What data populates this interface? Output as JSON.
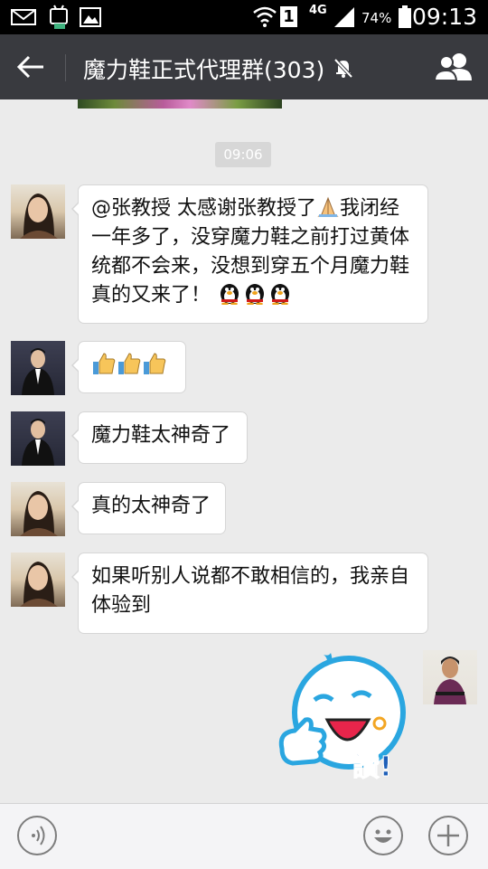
{
  "status_bar": {
    "signal_mode": "4G",
    "sim_badge": "1",
    "battery_percent": "74%",
    "time": "09:13",
    "icons": [
      "mail-icon",
      "android-icon",
      "image-icon",
      "wifi-icon",
      "signal-icon",
      "battery-icon"
    ]
  },
  "header": {
    "title": "魔力鞋正式代理群(303)",
    "icons": [
      "back-arrow-icon",
      "mute-bell-icon",
      "group-members-icon"
    ]
  },
  "chat": {
    "timestamp": "09:06",
    "messages": [
      {
        "sender": "woman-avatar",
        "text": "@张教授 太感谢张教授了",
        "text_after": "我闭经一年多了，没穿魔力鞋之前打过黄体统都不会来，没想到穿五个月魔力鞋真的又来了！",
        "emoji": [
          "pray-emoji",
          "penguin-emoji",
          "penguin-emoji",
          "penguin-emoji"
        ]
      },
      {
        "sender": "man-avatar",
        "text": "",
        "emoji": [
          "thumbs-up-emoji",
          "thumbs-up-emoji",
          "thumbs-up-emoji"
        ]
      },
      {
        "sender": "man-avatar",
        "text": "魔力鞋太神奇了"
      },
      {
        "sender": "woman-avatar",
        "text": "真的太神奇了"
      },
      {
        "sender": "woman-avatar",
        "text": "如果听别人说都不敢相信的，我亲自体验到"
      },
      {
        "sender": "self-avatar",
        "sticker": "thumbs-up-sticker",
        "sticker_text": "讚!"
      }
    ]
  },
  "input_bar": {
    "icons": [
      "voice-icon",
      "smiley-icon",
      "plus-icon"
    ]
  },
  "colors": {
    "status_bar": "#000000",
    "title_bar": "#393a3f",
    "chat_bg": "#ebebeb",
    "bubble": "#ffffff",
    "sticker_blue": "#2aa6e0",
    "sticker_text": "#1e5fb8"
  }
}
